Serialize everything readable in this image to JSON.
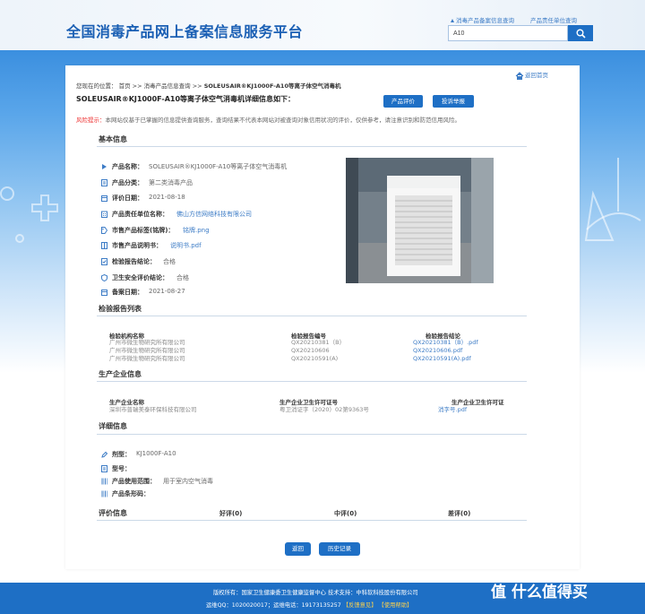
{
  "header": {
    "site_title": "全国消毒产品网上备案信息服务平台",
    "link_filing": "消毒产品备案信息查询",
    "link_company": "产品责任单位查询",
    "search_value": "A10"
  },
  "nav": {
    "back_home": "返回首页",
    "breadcrumb_prefix": "您现在的位置：",
    "breadcrumb_home": "首页",
    "breadcrumb_sep1": ">>",
    "breadcrumb_section": "消毒产品信息查询",
    "breadcrumb_sep2": ">>",
    "breadcrumb_current": "SOLEUSAIR®KJ1000F-A10等离子体空气消毒机"
  },
  "detail": {
    "title": "SOLEUSAIR®KJ1000F-A10等离子体空气消毒机详细信息如下：",
    "btn_evaluate": "产品评价",
    "btn_complain": "投诉举报",
    "risk_label": "风险提示：",
    "risk_text": "本网站仅基于已掌握的信息提供查询服务，查询结果不代表本网站对被查询对象信用状况的评价，仅供参考，请注意识别和防范信用风险。"
  },
  "basic": {
    "section_title": "基本信息",
    "rows": [
      {
        "label": "产品名称：",
        "value": "SOLEUSAIR®KJ1000F-A10等离子体空气消毒机"
      },
      {
        "label": "产品分类：",
        "value": "第二类消毒产品"
      },
      {
        "label": "评价日期：",
        "value": "2021-08-18"
      },
      {
        "label": "产品责任单位名称：",
        "value": "佛山方信网络科技有限公司"
      },
      {
        "label": "市售产品标签(铭牌)：",
        "value": "铭牌.png"
      },
      {
        "label": "市售产品说明书：",
        "value": "说明书.pdf"
      },
      {
        "label": "检验报告结论：",
        "value": "合格"
      },
      {
        "label": "卫生安全评价结论：",
        "value": "合格"
      },
      {
        "label": "备案日期：",
        "value": "2021-08-27"
      }
    ]
  },
  "reports": {
    "section_title": "检验报告列表",
    "headers": [
      "检验机构名称",
      "检验报告编号",
      "检验报告结论"
    ],
    "rows": [
      [
        "广州市微生物研究所有限公司",
        "QX20210381（B）",
        "QX20210381（B）.pdf"
      ],
      [
        "广州市微生物研究所有限公司",
        "QX20210606",
        "QX20210606.pdf"
      ],
      [
        "广州市微生物研究所有限公司",
        "QX20210591(A)",
        "QX20210591(A).pdf"
      ]
    ]
  },
  "producer": {
    "section_title": "生产企业信息",
    "headers": [
      "生产企业名称",
      "生产企业卫生许可证号",
      "生产企业卫生许可证"
    ],
    "row": [
      "深圳市普瑞美泰环保科技有限公司",
      "粤卫消证字（2020）02第9363号",
      "消字号.pdf"
    ]
  },
  "details": {
    "section_title": "详细信息",
    "rows": [
      {
        "label": "剂型：",
        "value": "KJ1000F-A10"
      },
      {
        "label": "型号：",
        "value": ""
      },
      {
        "label": "产品使用范围：",
        "value": "用于室内空气消毒"
      },
      {
        "label": "产品条形码：",
        "value": ""
      }
    ]
  },
  "evaluation": {
    "section_title": "评价信息",
    "good": "好评(0)",
    "neutral": "中评(0)",
    "bad": "差评(0)"
  },
  "actions": {
    "back": "返回",
    "history": "历史记录"
  },
  "footer": {
    "line1": "版权所有：国家卫生健康委卫生健康监督中心  技术支持：中科软科技股份有限公司",
    "line2_prefix": "运维QQ：1020020017；运维电话：19173135257",
    "link_feedback": "【反馈意见】",
    "link_help": "【使用帮助】",
    "watermark": "值 什么值得买"
  },
  "colors": {
    "primary": "#1e6fc5",
    "link": "#3d7cc6",
    "risk": "#e33333"
  }
}
